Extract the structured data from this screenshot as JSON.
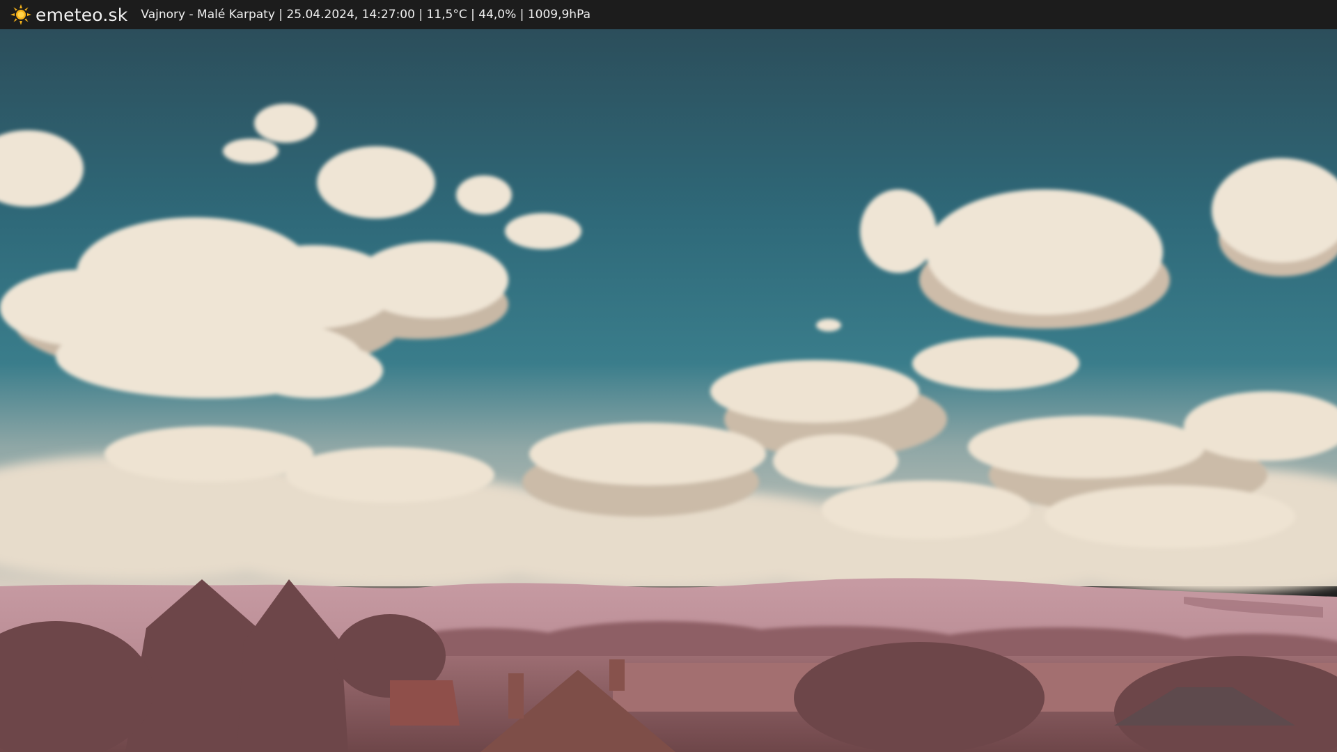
{
  "header": {
    "brand": "emeteo.sk",
    "location": "Vajnory - Malé Karpaty",
    "datetime": "25.04.2024, 14:27:00",
    "temperature": "11,5°C",
    "humidity": "44,0%",
    "pressure": "1009,9hPa",
    "separator": " | ",
    "logo_icon": "sun-icon",
    "logo_color": "#f5b21a"
  },
  "scene": {
    "sky_top_color": "#2f5360",
    "sky_mid_color": "#357a8a",
    "cloud_color": "#eee3d2",
    "cloud_shade_color": "#c9b9a6",
    "hill_color": "#b98d95",
    "tree_color": "#7a4f54",
    "roof_color": "#8f5550"
  }
}
